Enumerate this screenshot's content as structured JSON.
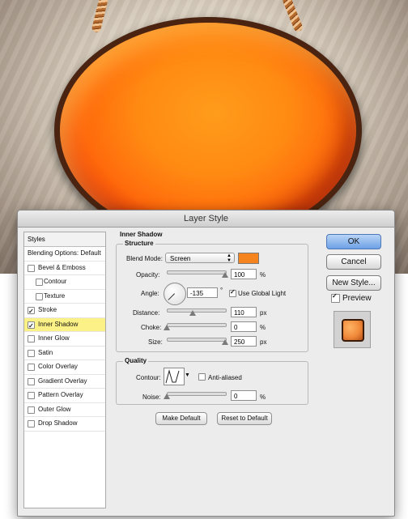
{
  "dialog": {
    "title": "Layer Style"
  },
  "styles_panel": {
    "header": "Styles",
    "items": [
      {
        "label": "Blending Options: Default",
        "checkbox": false,
        "checked": false,
        "indent": 0,
        "selected": false
      },
      {
        "label": "Bevel & Emboss",
        "checkbox": true,
        "checked": false,
        "indent": 1,
        "selected": false
      },
      {
        "label": "Contour",
        "checkbox": true,
        "checked": false,
        "indent": 2,
        "selected": false
      },
      {
        "label": "Texture",
        "checkbox": true,
        "checked": false,
        "indent": 2,
        "selected": false
      },
      {
        "label": "Stroke",
        "checkbox": true,
        "checked": true,
        "indent": 1,
        "selected": false
      },
      {
        "label": "Inner Shadow",
        "checkbox": true,
        "checked": true,
        "indent": 1,
        "selected": true
      },
      {
        "label": "Inner Glow",
        "checkbox": true,
        "checked": false,
        "indent": 1,
        "selected": false
      },
      {
        "label": "Satin",
        "checkbox": true,
        "checked": false,
        "indent": 1,
        "selected": false
      },
      {
        "label": "Color Overlay",
        "checkbox": true,
        "checked": false,
        "indent": 1,
        "selected": false
      },
      {
        "label": "Gradient Overlay",
        "checkbox": true,
        "checked": false,
        "indent": 1,
        "selected": false
      },
      {
        "label": "Pattern Overlay",
        "checkbox": true,
        "checked": false,
        "indent": 1,
        "selected": false
      },
      {
        "label": "Outer Glow",
        "checkbox": true,
        "checked": false,
        "indent": 1,
        "selected": false
      },
      {
        "label": "Drop Shadow",
        "checkbox": true,
        "checked": false,
        "indent": 1,
        "selected": false
      }
    ]
  },
  "inner_shadow": {
    "section_title": "Inner Shadow",
    "structure": {
      "title": "Structure",
      "blend_mode_label": "Blend Mode:",
      "blend_mode_value": "Screen",
      "shadow_color": "#f5841f",
      "opacity_label": "Opacity:",
      "opacity_value": "100",
      "opacity_unit": "%",
      "opacity_level": 1.0,
      "angle_label": "Angle:",
      "angle_value": "-135",
      "angle_unit": "°",
      "use_global_light_label": "Use Global Light",
      "use_global_light_checked": true,
      "distance_label": "Distance:",
      "distance_value": "110",
      "distance_unit": "px",
      "distance_level": 0.44,
      "choke_label": "Choke:",
      "choke_value": "0",
      "choke_unit": "%",
      "choke_level": 0.0,
      "size_label": "Size:",
      "size_value": "250",
      "size_unit": "px",
      "size_level": 1.0
    },
    "quality": {
      "title": "Quality",
      "contour_label": "Contour:",
      "anti_aliased_label": "Anti-aliased",
      "anti_aliased_checked": false,
      "noise_label": "Noise:",
      "noise_value": "0",
      "noise_unit": "%",
      "noise_level": 0.0
    },
    "make_default_label": "Make Default",
    "reset_default_label": "Reset to Default"
  },
  "buttons": {
    "ok_label": "OK",
    "cancel_label": "Cancel",
    "new_style_label": "New Style...",
    "preview_label": "Preview",
    "preview_checked": true
  },
  "colors": {
    "egg_fill": "#ff7a10",
    "egg_outline": "#4a2410",
    "selected_style_bg": "#fbf186"
  }
}
